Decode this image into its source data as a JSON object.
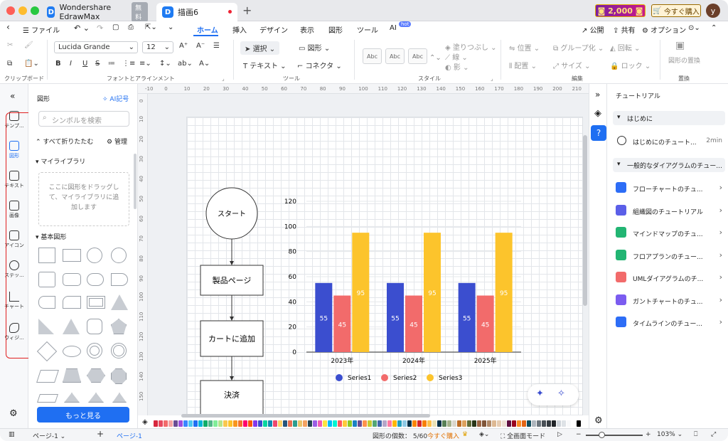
{
  "app": {
    "name": "Wondershare EdrawMax",
    "free_badge": "無料",
    "doc_tab": "描画6",
    "coins": "2,000",
    "buy_now": "今すぐ購入",
    "user_initial": "y"
  },
  "menu": {
    "file": "ファイル",
    "tabs": [
      "ホーム",
      "挿入",
      "デザイン",
      "表示",
      "図形",
      "ツール",
      "AI"
    ],
    "ai_badge": "hot",
    "publish": "公開",
    "share": "共有",
    "options": "オプション"
  },
  "ribbon": {
    "font_name": "Lucida Grande",
    "font_size": "12",
    "select": "選択",
    "shape": "図形",
    "text": "テキスト",
    "connector": "コネクタ",
    "fill": "塗りつぶし",
    "line": "線",
    "shadow": "影",
    "position": "位置",
    "group": "グループ化",
    "rotate": "回転",
    "align": "配置",
    "size": "サイズ",
    "lock": "ロック",
    "replace_shape": "図形の置換",
    "style_swatch": "Abc",
    "groups": {
      "clipboard": "クリップボード",
      "font": "フォントとアラインメント",
      "tools": "ツール",
      "style": "スタイル",
      "edit": "編集",
      "replace": "置換"
    }
  },
  "rail": [
    "テンプ...",
    "図形",
    "テキスト",
    "画像",
    "アイコン",
    "ステッ...",
    "チャート",
    "ウィジ..."
  ],
  "panel": {
    "title": "図形",
    "ai_symbol": "AI記号",
    "search_placeholder": "シンボルを検索",
    "collapse_all": "すべて折りたたむ",
    "manage": "管理",
    "my_library": "マイライブラリ",
    "drop_hint": "ここに図形をドラッグして、マイライブラリに追加します",
    "basic_shapes": "基本図形",
    "more": "もっと見る"
  },
  "ruler_h": [
    "-10",
    "0",
    "10",
    "20",
    "30",
    "40",
    "50",
    "60",
    "70",
    "80",
    "90",
    "100",
    "110",
    "120",
    "130",
    "140",
    "150",
    "160",
    "170",
    "180",
    "190",
    "200",
    "210"
  ],
  "ruler_v": [
    "0",
    "10",
    "20",
    "30",
    "40",
    "50",
    "60",
    "70",
    "80",
    "90",
    "100",
    "110",
    "120",
    "130",
    "140",
    "150"
  ],
  "flowchart": {
    "start": "スタート",
    "step1": "製品ページ",
    "step2": "カートに追加",
    "step3": "決済"
  },
  "chart_data": {
    "type": "bar",
    "categories": [
      "2023年",
      "2024年",
      "2025年"
    ],
    "series": [
      {
        "name": "Series1",
        "values": [
          55,
          55,
          55
        ],
        "color": "#3b4ecf"
      },
      {
        "name": "Series2",
        "values": [
          45,
          45,
          45
        ],
        "color": "#f26b6b"
      },
      {
        "name": "Series3",
        "values": [
          95,
          95,
          95
        ],
        "color": "#fcc42c"
      }
    ],
    "yticks": [
      "0",
      "20",
      "40",
      "60",
      "80",
      "100",
      "120"
    ],
    "ylim": [
      0,
      120
    ],
    "legend": "bottom"
  },
  "tutorial": {
    "title": "チュートリアル",
    "intro": "はじめに",
    "intro_item": "はじめにのチュート...",
    "intro_time": "2min",
    "general": "一般的なダイアグラムのチュー...",
    "items": [
      "フローチャートのチュ...",
      "組織図のチュートリアル",
      "マインドマップのチュ...",
      "フロアプランのチュー...",
      "UMLダイアグラムのチ...",
      "ガントチャートのチュ...",
      "タイムラインのチュー..."
    ],
    "colors": [
      "#2d6df6",
      "#5b5fe8",
      "#22b573",
      "#22b573",
      "#f26b6b",
      "#7b5cf0",
      "#2d6df6"
    ]
  },
  "status": {
    "page_select": "ページ-1",
    "page_tab": "ページ-1",
    "shape_count": "図形の個数： 5/60",
    "buy": "今すぐ購入",
    "fullscreen": "全画面モード",
    "zoom": "103%"
  }
}
